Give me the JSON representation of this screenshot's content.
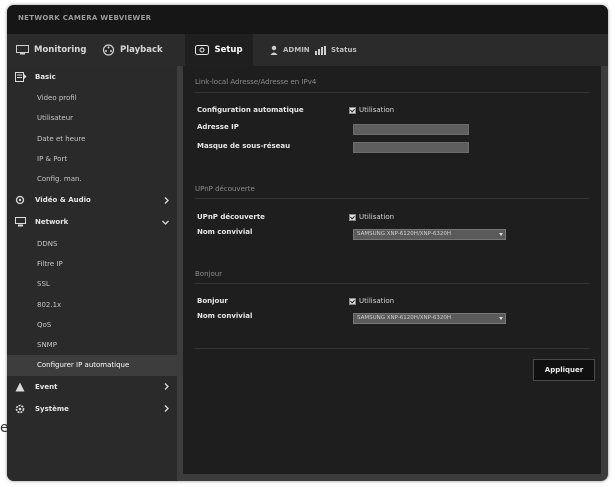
{
  "stray_char": "e",
  "title": "NETWORK CAMERA WEBVIEWER",
  "nav": {
    "monitoring": "Monitoring",
    "playback": "Playback",
    "setup": "Setup",
    "user": "ADMIN",
    "status": "Status"
  },
  "sidebar": {
    "basic": {
      "label": "Basic",
      "items": [
        "Video profil",
        "Utilisateur",
        "Date et heure",
        "IP & Port",
        "Config. man."
      ]
    },
    "video_audio": "Vidéo & Audio",
    "network": {
      "label": "Network",
      "items": [
        "DDNS",
        "Filtre IP",
        "SSL",
        "802.1x",
        "QoS",
        "SNMP",
        "Configurer IP automatique"
      ]
    },
    "event": "Event",
    "system": "Système"
  },
  "main": {
    "sec1": {
      "title": "Link-local Adresse/Adresse en IPv4",
      "config_label": "Configuration automatique",
      "config_check": "Utilisation",
      "ip_label": "Adresse IP",
      "mask_label": "Masque de sous-réseau",
      "ip_value": "",
      "mask_value": ""
    },
    "sec2": {
      "title": "UPnP découverte",
      "label": "UPnP découverte",
      "check": "Utilisation",
      "name_label": "Nom convivial",
      "name_value": "SAMSUNG XNP-6120H/XNP-6320H"
    },
    "sec3": {
      "title": "Bonjour",
      "label": "Bonjour",
      "check": "Utilisation",
      "name_label": "Nom convivial",
      "name_value": "SAMSUNG XNP-6120H/XNP-6320H"
    },
    "apply": "Appliquer"
  }
}
